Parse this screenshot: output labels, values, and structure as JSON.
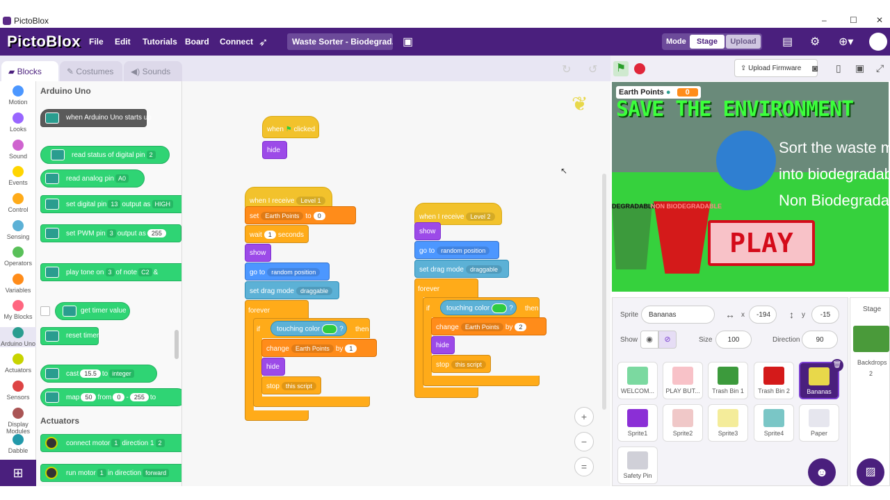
{
  "window": {
    "title": "PictoBlox",
    "min": "–",
    "max": "☐",
    "close": "✕"
  },
  "menubar": {
    "logo": "PictoBlox",
    "items": [
      "File",
      "Edit",
      "Tutorials",
      "Board",
      "Connect"
    ],
    "project_title": "Waste Sorter - Biodegrad...",
    "mode_label": "Mode",
    "mode_stage": "Stage",
    "mode_upload": "Upload"
  },
  "tabs": {
    "blocks": "Blocks",
    "costumes": "Costumes",
    "sounds": "Sounds"
  },
  "categories": [
    {
      "label": "Motion",
      "color": "#4c97ff"
    },
    {
      "label": "Looks",
      "color": "#9966ff"
    },
    {
      "label": "Sound",
      "color": "#cf63cf"
    },
    {
      "label": "Events",
      "color": "#ffd500"
    },
    {
      "label": "Control",
      "color": "#ffab19"
    },
    {
      "label": "Sensing",
      "color": "#5cb1d6"
    },
    {
      "label": "Operators",
      "color": "#59c059"
    },
    {
      "label": "Variables",
      "color": "#ff8c1a"
    },
    {
      "label": "My Blocks",
      "color": "#ff6680"
    },
    {
      "label": "Arduino Uno",
      "color": "#2a9d8f"
    },
    {
      "label": "Actuators",
      "color": "#c8d400"
    },
    {
      "label": "Sensors",
      "color": "#d44"
    },
    {
      "label": "Display Modules",
      "color": "#a55"
    },
    {
      "label": "Dabble",
      "color": "#29a"
    }
  ],
  "palette": {
    "heading": "Arduino Uno",
    "heading2": "Actuators",
    "b_start": "when Arduino Uno starts up",
    "b_readdig": "read status of digital pin",
    "b_readdig_v": "2",
    "b_readana": "read analog pin",
    "b_readana_v": "A0",
    "b_setdig": "set digital pin",
    "b_setdig_v": "13",
    "b_setdig_out": "output as",
    "b_setdig_h": "HIGH",
    "b_pwm": "set PWM pin",
    "b_pwm_v": "3",
    "b_pwm_out": "output as",
    "b_pwm_val": "255",
    "b_tone": "play tone on",
    "b_tone_v": "3",
    "b_tone_note": "of note",
    "b_tone_nv": "C2",
    "b_tone_amp": "&",
    "b_timer": "get timer value",
    "b_reset": "reset timer",
    "b_cast": "cast",
    "b_cast_v": "15.5",
    "b_cast_to": "to",
    "b_cast_t": "integer",
    "b_map": "map",
    "b_map_v": "50",
    "b_map_from": "from",
    "b_map_a": "0",
    "b_map_dash": "-",
    "b_map_b": "255",
    "b_map_to": "to",
    "b_motor": "connect motor",
    "b_motor_v": "1",
    "b_motor_dir": "direction 1",
    "b_motor_dv": "2",
    "b_run": "run motor",
    "b_run_v": "1",
    "b_run_dir": "in direction",
    "b_run_dv": "forward"
  },
  "scripts": {
    "s1_when": "when",
    "s1_clicked": "clicked",
    "s1_hide": "hide",
    "s2_recv": "when I receive",
    "s2_recv_v": "Level 1",
    "s2_set": "set",
    "s2_set_var": "Earth Points",
    "s2_set_to": "to",
    "s2_set_val": "0",
    "s2_wait": "wait",
    "s2_wait_v": "1",
    "s2_wait_s": "seconds",
    "s2_show": "show",
    "s2_goto": "go to",
    "s2_goto_v": "random position",
    "s2_drag": "set drag mode",
    "s2_drag_v": "draggable",
    "s2_forever": "forever",
    "s2_if": "if",
    "s2_touch": "touching color",
    "s2_q": "?",
    "s2_then": "then",
    "s2_change": "change",
    "s2_change_var": "Earth Points",
    "s2_by": "by",
    "s2_by_v": "1",
    "s2_hide": "hide",
    "s2_stop": "stop",
    "s2_stop_v": "this script",
    "s3_recv": "when I receive",
    "s3_recv_v": "Level 2",
    "s3_show": "show",
    "s3_goto": "go to",
    "s3_goto_v": "random position",
    "s3_drag": "set drag mode",
    "s3_drag_v": "draggable",
    "s3_forever": "forever",
    "s3_if": "if",
    "s3_touch": "touching color",
    "s3_q": "?",
    "s3_then": "then",
    "s3_change": "change",
    "s3_change_var": "Earth Points",
    "s3_by": "by",
    "s3_by_v": "2",
    "s3_hide": "hide",
    "s3_stop": "stop",
    "s3_stop_v": "this script"
  },
  "toolbar": {
    "upload_firmware": "Upload Firmware"
  },
  "stage": {
    "var_name": "Earth Points",
    "var_value": "0",
    "title": "SAVE THE ENVIRONMENT",
    "line1": "Sort the waste material",
    "line2": "into biodegradable and",
    "line3": "Non Biodegradable",
    "bin1_label": "DEGRADABLE",
    "bin2_label": "NON BIODEGRADABLE",
    "play": "PLAY"
  },
  "sprite_info": {
    "sprite_label": "Sprite",
    "sprite_name": "Bananas",
    "x_label": "x",
    "x_val": "-194",
    "y_label": "y",
    "y_val": "-15",
    "show_label": "Show",
    "size_label": "Size",
    "size_val": "100",
    "dir_label": "Direction",
    "dir_val": "90"
  },
  "sprites": [
    {
      "name": "WELCOM...",
      "color": "#7bd9a0"
    },
    {
      "name": "PLAY BUT...",
      "color": "#f8c2c8"
    },
    {
      "name": "Trash Bin 1",
      "color": "#3c9a3c"
    },
    {
      "name": "Trash Bin 2",
      "color": "#d41a1a"
    },
    {
      "name": "Bananas",
      "color": "#e8d84a"
    },
    {
      "name": "Sprite1",
      "color": "#8b2fd6"
    },
    {
      "name": "Sprite2",
      "color": "#f0c8c8"
    },
    {
      "name": "Sprite3",
      "color": "#f4ec9a"
    },
    {
      "name": "Sprite4",
      "color": "#7ac6c6"
    },
    {
      "name": "Paper",
      "color": "#e6e6ee"
    },
    {
      "name": "Safety Pin",
      "color": "#d0d0d8"
    }
  ],
  "stage_pane": {
    "label": "Stage",
    "backdrops_label": "Backdrops",
    "backdrops_count": "2"
  }
}
